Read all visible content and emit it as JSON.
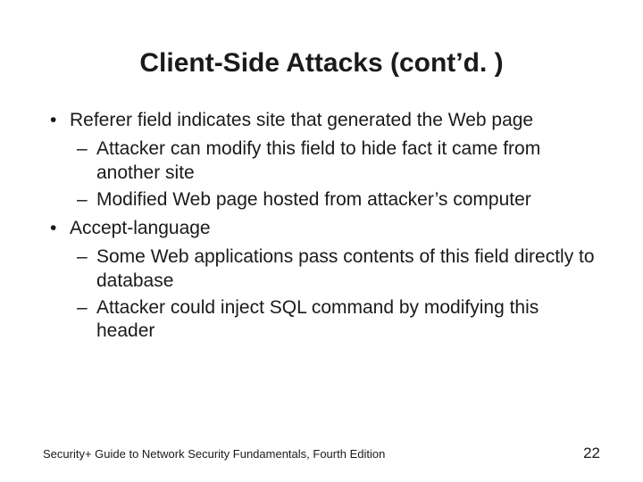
{
  "title": "Client-Side Attacks (cont’d. )",
  "bullets": {
    "b1": "Referer field indicates site that generated the Web page",
    "b1_1": "Attacker can modify this field to hide fact it came from another site",
    "b1_2": "Modified Web page hosted from attacker’s computer",
    "b2": "Accept-language",
    "b2_1": "Some Web applications pass contents of this field directly to database",
    "b2_2": "Attacker could inject SQL command by modifying this header"
  },
  "footer": {
    "source": "Security+ Guide to Network Security Fundamentals, Fourth Edition",
    "page": "22"
  }
}
